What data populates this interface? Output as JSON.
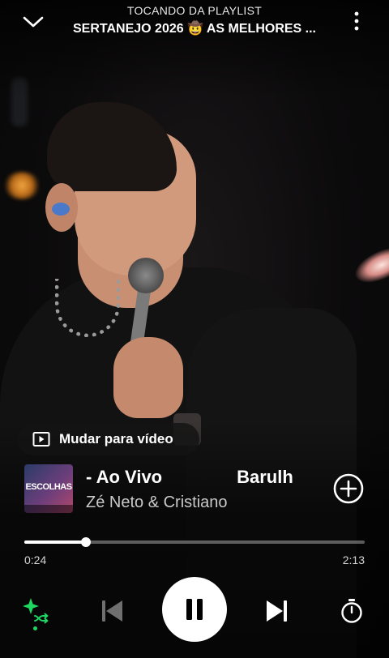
{
  "header": {
    "playing_from": "TOCANDO DA PLAYLIST",
    "playlist_name": "SERTANEJO 2026 🤠 AS MELHORES ..."
  },
  "video_toggle": {
    "label": "Mudar para vídeo"
  },
  "track": {
    "title_parts": [
      "- Ao Vivo",
      "Barulh"
    ],
    "artist": "Zé Neto & Cristiano",
    "cover_text": "ESCOLHAS"
  },
  "progress": {
    "current": "0:24",
    "total": "2:13",
    "fraction": 0.18
  },
  "colors": {
    "accent": "#1ed760",
    "background": "#0b0b0b"
  },
  "icons": {
    "collapse": "chevron-down-icon",
    "more": "more-vertical-icon",
    "video": "video-play-icon",
    "add": "add-circle-icon",
    "smart_shuffle": "smart-shuffle-icon",
    "prev": "skip-previous-icon",
    "play_pause": "pause-icon",
    "next": "skip-next-icon",
    "sleep_timer": "timer-icon"
  }
}
